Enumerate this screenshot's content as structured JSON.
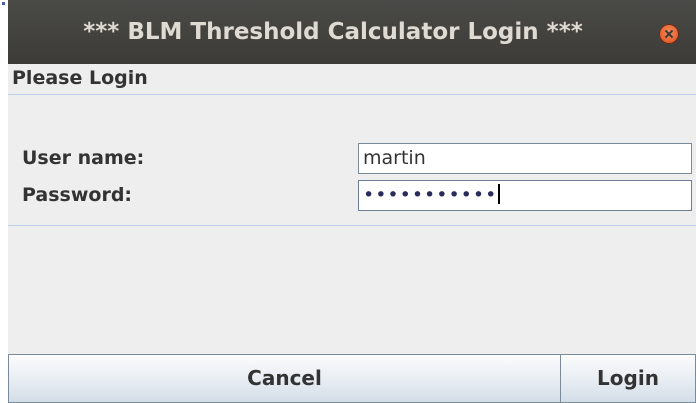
{
  "window": {
    "title": "*** BLM Threshold Calculator Login ***"
  },
  "header": {
    "text": "Please Login"
  },
  "form": {
    "username_label": "User name:",
    "username_value": "martin",
    "password_label": "Password:",
    "password_masked": "•••••••••••"
  },
  "buttons": {
    "cancel_label": "Cancel",
    "login_label": "Login"
  },
  "colors": {
    "titlebar": "#3c3b37",
    "title_text": "#dfdbd2",
    "close_button": "#e55c2b",
    "panel_bg": "#eeeeee",
    "separator": "#b8cfe5"
  }
}
